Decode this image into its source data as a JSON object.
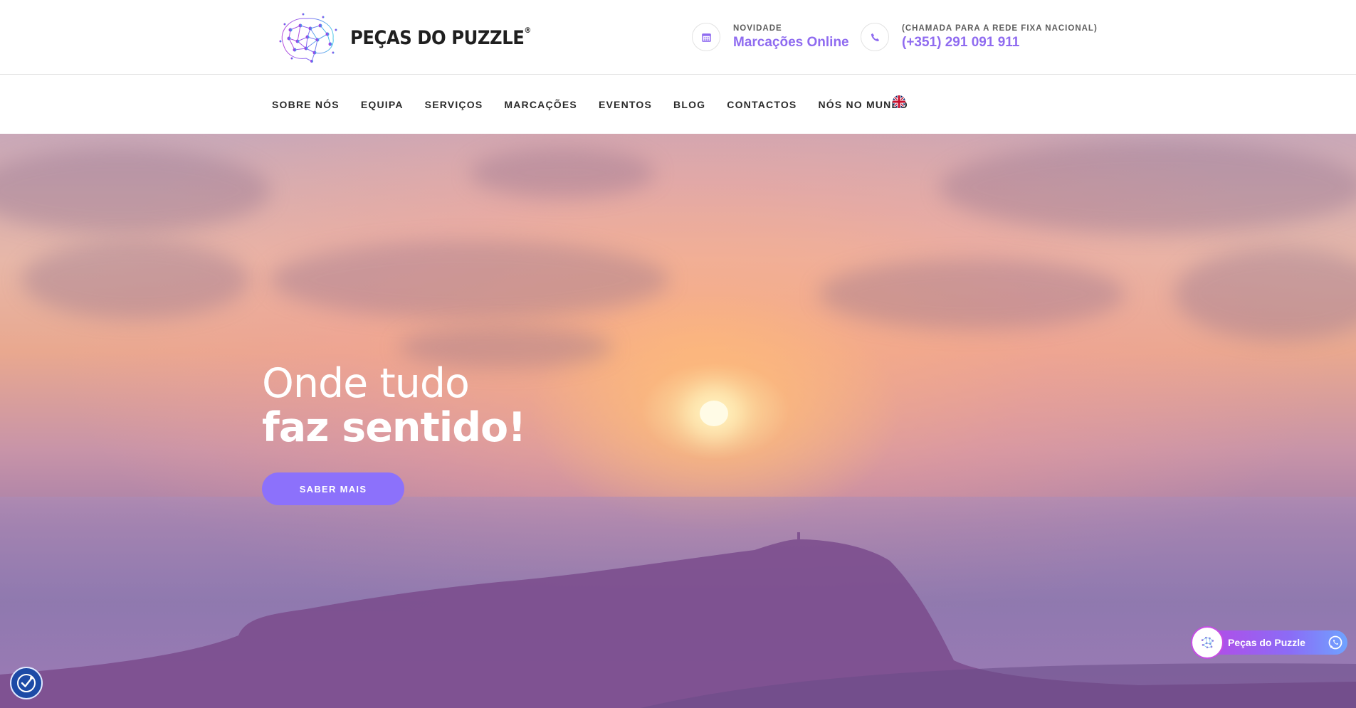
{
  "brand": {
    "name": "PEÇAS DO PUZZLE",
    "registered": "®"
  },
  "header": {
    "contacts": [
      {
        "caption": "NOVIDADE",
        "value": "Marcações Online",
        "icon": "calendar-icon"
      },
      {
        "caption": "(CHAMADA PARA A REDE FIXA NACIONAL)",
        "value": "(+351) 291 091 911",
        "icon": "phone-icon"
      }
    ]
  },
  "nav": {
    "items": [
      {
        "label": "SOBRE NÓS"
      },
      {
        "label": "EQUIPA"
      },
      {
        "label": "SERVIÇOS"
      },
      {
        "label": "MARCAÇÕES"
      },
      {
        "label": "EVENTOS"
      },
      {
        "label": "BLOG"
      },
      {
        "label": "CONTACTOS"
      },
      {
        "label": "NÓS NO MUNDO"
      }
    ],
    "language_icon": "uk-flag-icon"
  },
  "hero": {
    "line1": "Onde tudo",
    "line2": "faz sentido!",
    "cta": "SABER MAIS"
  },
  "whatsapp": {
    "label": "Peças do Puzzle",
    "icon": "whatsapp-icon"
  },
  "accessibility": {
    "icon": "accessibility-icon"
  },
  "colors": {
    "accent": "#8f6bf0",
    "button": "#8c71fb",
    "a11y": "#1c4aa6"
  }
}
